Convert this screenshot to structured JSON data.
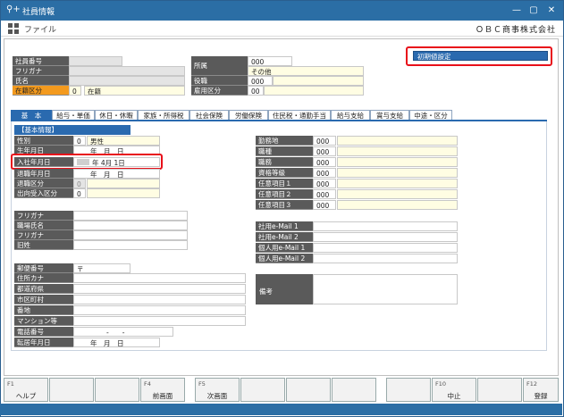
{
  "titlebar": {
    "icon": "⚲+",
    "title": "社員情報",
    "minimize": "—",
    "maximize": "▢",
    "close": "✕"
  },
  "menubar": {
    "file": "ファイル",
    "company": "ＯＢＣ商事株式会社"
  },
  "header": {
    "employee_no_label": "社員番号",
    "furigana_label": "フリガナ",
    "name_label": "氏名",
    "status_label": "在籍区分",
    "status_code": "0",
    "status_text": "在籍",
    "dept_label": "所属",
    "dept_code": "000",
    "dept_name": "その他",
    "position_label": "役職",
    "position_code": "000",
    "employment_label": "雇用区分",
    "employment_code": "00"
  },
  "init_button": "初期値設定",
  "tabs": [
    "基　本",
    "給与・単価",
    "休日・休暇",
    "家族・所得税",
    "社会保険",
    "労働保険",
    "住民税・通勤手当",
    "給与支給",
    "賞与支給",
    "中途・区分"
  ],
  "basic": {
    "section": "【基本情報】",
    "gender_label": "性別",
    "gender_code": "0",
    "gender_text": "男性",
    "birth_label": "生年月日",
    "birth_value": "年　月　日",
    "hire_label": "入社年月日",
    "hire_value": "年  4月  1日",
    "retire_date_label": "退職年月日",
    "retire_date_value": "年　月　日",
    "retire_type_label": "退職区分",
    "retire_type_value": "0",
    "secondment_label": "出向受入区分",
    "secondment_value": "0",
    "kana_label": "フリガナ",
    "job_name_label": "職場氏名",
    "kana2_label": "フリガナ",
    "old_name_label": "旧姓",
    "postal_label": "郵便番号",
    "postal_value": "〒",
    "addr_kana_label": "住所カナ",
    "pref_label": "都道府県",
    "city_label": "市区町村",
    "street_label": "番地",
    "building_label": "マンション等",
    "phone_label": "電話番号",
    "phone_value": "-　　-",
    "move_date_label": "転居年月日",
    "move_date_value": "年　月　日"
  },
  "work": {
    "workplace_label": "勤務地",
    "workplace_code": "000",
    "job_type_label": "職種",
    "job_type_code": "000",
    "job_title_label": "職務",
    "job_title_code": "000",
    "grade_label": "資格等級",
    "grade_code": "000",
    "opt1_label": "任意項目１",
    "opt1_code": "000",
    "opt2_label": "任意項目２",
    "opt2_code": "000",
    "opt3_label": "任意項目３",
    "opt3_code": "000"
  },
  "email": {
    "work1_label": "社用e-Mail 1",
    "work2_label": "社用e-Mail 2",
    "personal1_label": "個人用e-Mail 1",
    "personal2_label": "個人用e-Mail 2"
  },
  "memo_label": "備考",
  "fkeys": [
    {
      "key": "F1",
      "label": "ヘルプ"
    },
    {
      "key": "",
      "label": ""
    },
    {
      "key": "",
      "label": ""
    },
    {
      "key": "F4",
      "label": "前画面"
    },
    {
      "key": "F5",
      "label": "次画面"
    },
    {
      "key": "",
      "label": ""
    },
    {
      "key": "",
      "label": ""
    },
    {
      "key": "",
      "label": ""
    },
    {
      "key": "",
      "label": ""
    },
    {
      "key": "F10",
      "label": "中止"
    },
    {
      "key": "",
      "label": ""
    },
    {
      "key": "F12",
      "label": "登録"
    }
  ]
}
